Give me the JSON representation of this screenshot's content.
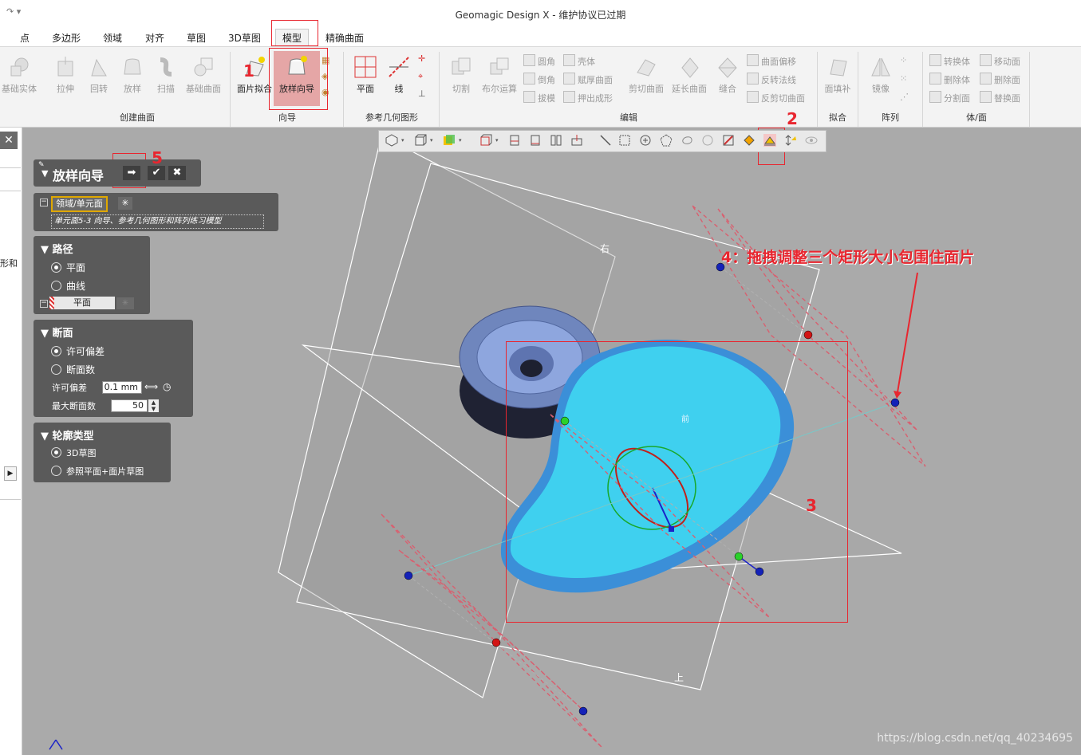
{
  "window": {
    "title": "Geomagic Design X - 维护协议已过期"
  },
  "menu_tabs": [
    "点",
    "多边形",
    "领域",
    "对齐",
    "草图",
    "3D草图",
    "模型",
    "精确曲面"
  ],
  "active_tab": "模型",
  "ribbon": {
    "create_surface": {
      "group": "创建曲面",
      "buttons": [
        "基础实体",
        "拉伸",
        "回转",
        "放样",
        "扫描",
        "基础曲面"
      ]
    },
    "wizard": {
      "group": "向导",
      "buttons": [
        "面片拟合",
        "放样向导"
      ]
    },
    "ref_geom": {
      "group": "参考几何图形",
      "buttons": [
        "平面",
        "线"
      ]
    },
    "edit": {
      "group": "编辑",
      "buttons": [
        "切割",
        "布尔运算",
        "剪切曲面",
        "延长曲面",
        "缝合"
      ],
      "small": [
        "圆角",
        "倒角",
        "拔模",
        "壳体",
        "赋厚曲面",
        "押出成形",
        "曲面偏移",
        "反转法线",
        "反剪切曲面"
      ]
    },
    "fit": {
      "group": "拟合",
      "buttons": [
        "面填补"
      ]
    },
    "array": {
      "group": "阵列",
      "buttons": [
        "镜像"
      ]
    },
    "body": {
      "group": "体/面",
      "small": [
        "转换体",
        "删除体",
        "分割面",
        "移动面",
        "删除面",
        "替换面"
      ]
    }
  },
  "left_strip": {
    "fragment_text": "形和"
  },
  "wizard_panel": {
    "title": "放样向导",
    "region_label": "领域/单元面",
    "region_value": "单元面5-3 向导、参考几何图形和阵列练习模型",
    "path": {
      "title": "路径",
      "options": [
        "平面",
        "曲线"
      ],
      "selected": "平面",
      "field": "平面"
    },
    "section": {
      "title": "断面",
      "options": [
        "许可偏差",
        "断面数"
      ],
      "selected": "许可偏差",
      "tolerance_label": "许可偏差",
      "tolerance_value": "0.1 mm",
      "max_label": "最大断面数",
      "max_value": "50"
    },
    "profile": {
      "title": "轮廓类型",
      "options": [
        "3D草图",
        "参照平面+面片草图"
      ],
      "selected": "3D草图"
    }
  },
  "viewport_labels": {
    "right": "右",
    "top": "上",
    "front": "前"
  },
  "annotations": {
    "n1": "1",
    "n2": "2",
    "n3": "3",
    "n4": "4：拖拽调整三个矩形大小包围住面片",
    "n5": "5"
  },
  "watermark": "https://blog.csdn.net/qq_40234695",
  "colors": {
    "annotation": "#e8262f",
    "mesh": "#3fd0ef",
    "panel": "#5a5a5a"
  }
}
